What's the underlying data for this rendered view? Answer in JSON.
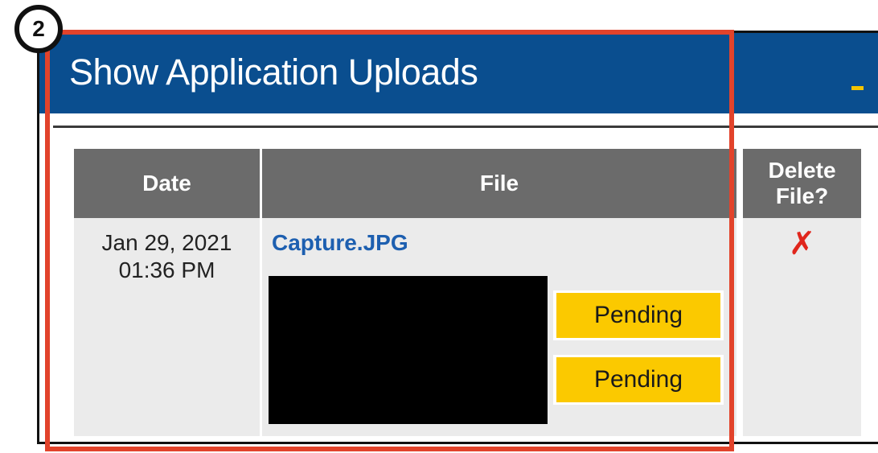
{
  "step_badge": "2",
  "panel": {
    "title": "Show Application Uploads",
    "collapse_icon": "minus-icon"
  },
  "table": {
    "headers": {
      "date": "Date",
      "file": "File",
      "delete_line1": "Delete",
      "delete_line2": "File?"
    },
    "rows": [
      {
        "date_line1": "Jan 29, 2021",
        "date_line2": "01:36 PM",
        "file_name": "Capture.JPG",
        "statuses": [
          "Pending",
          "Pending"
        ],
        "delete_icon": "✗"
      }
    ]
  },
  "colors": {
    "header_blue": "#0a4e8f",
    "highlight_red": "#e2432b",
    "pending_yellow": "#fbc900",
    "link_blue": "#1d5fb0",
    "delete_red": "#e0261c"
  }
}
